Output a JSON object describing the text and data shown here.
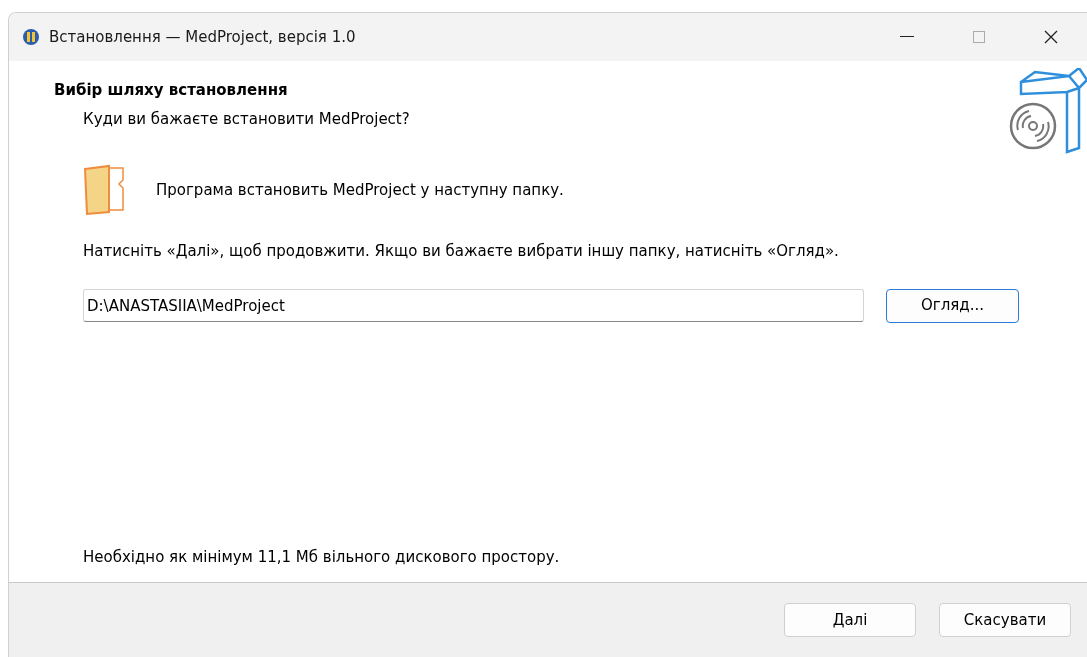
{
  "window": {
    "title": "Встановлення — MedProject, версія 1.0"
  },
  "header": {
    "title": "Вибір шляху встановлення",
    "subtitle": "Куди ви бажаєте встановити MedProject?"
  },
  "intro": "Програма встановить MedProject у наступну папку.",
  "instruction": "Натисніть «Далі», щоб продовжити. Якщо ви бажаєте вибрати іншу папку, натисніть «Огляд».",
  "path_field": {
    "value": "D:\\ANASTASIIA\\MedProject"
  },
  "browse_button": "Огляд...",
  "disk_space": "Необхідно як мінімум 11,1 Мб вільного дискового простору.",
  "buttons": [
    "Далі",
    "Скасувати"
  ]
}
